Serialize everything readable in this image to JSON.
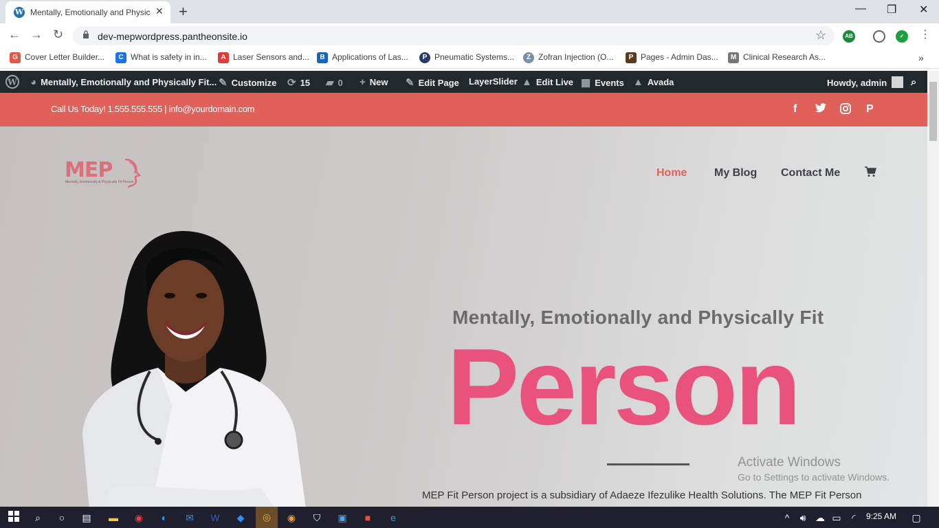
{
  "browser": {
    "tab_title": "Mentally, Emotionally and Physic",
    "url": "dev-mepwordpress.pantheonsite.io",
    "bookmarks": [
      {
        "label": "Cover Letter Builder...",
        "icon": "G",
        "color": "#e8563f"
      },
      {
        "label": "What is safety in in...",
        "icon": "C",
        "color": "#1a73e8"
      },
      {
        "label": "Laser Sensors and...",
        "icon": "A",
        "color": "#e53935"
      },
      {
        "label": "Applications of Las...",
        "icon": "B",
        "color": "#1565c0"
      },
      {
        "label": "Pneumatic Systems...",
        "icon": "P",
        "color": "#2b3a67"
      },
      {
        "label": "Zofran Injection (O...",
        "icon": "Z",
        "color": "#7b8fa8"
      },
      {
        "label": "Pages - Admin Das...",
        "icon": "P",
        "color": "#5a3a1c"
      },
      {
        "label": "Clinical Research As...",
        "icon": "M",
        "color": "#777"
      }
    ],
    "extensions": [
      {
        "name": "adblock-icon",
        "label": "AB",
        "color": "#1b8a3c"
      },
      {
        "name": "profile-icon",
        "label": "",
        "color": "#9aa0a6"
      },
      {
        "name": "shield-check-icon",
        "label": "",
        "color": "#1e9e3e"
      }
    ]
  },
  "adminbar": {
    "site_title": "Mentally, Emotionally and Physically Fit...",
    "customize": "Customize",
    "updates": "15",
    "comments": "0",
    "new": "New",
    "edit_page": "Edit Page",
    "layerslider": "LayerSlider",
    "edit_live": "Edit Live",
    "events": "Events",
    "avada": "Avada",
    "howdy": "Howdy, admin"
  },
  "topbar": {
    "contact": "Call Us Today! 1.555.555.555  |  info@yourdomain.com"
  },
  "site": {
    "logo_text": "MEP",
    "logo_tagline": "Mentally, Emotionally & Physically Fit Person",
    "nav": [
      "Home",
      "My Blog",
      "Contact Me"
    ],
    "hero_subtitle": "Mentally, Emotionally and Physically Fit",
    "hero_word": "Person",
    "hero_description": "MEP Fit Person project is a subsidiary of Adaeze Ifezulike Health Solutions. The MEP Fit Person"
  },
  "watermark": {
    "heading": "Activate Windows",
    "sub": "Go to Settings to activate Windows."
  },
  "taskbar": {
    "time": "9:25 AM"
  },
  "colors": {
    "accent": "#e0615a",
    "hero_word": "#e8527d",
    "adminbar": "#23282d"
  }
}
